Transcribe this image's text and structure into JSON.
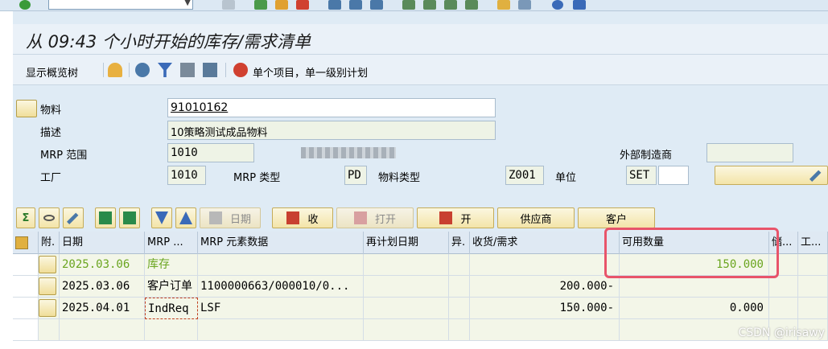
{
  "title": "从 09:43 个小时开始的库存/需求清单",
  "app_toolbar": {
    "show_tree": "显示概览树",
    "single_item": "单个项目，单一级别计划"
  },
  "header": {
    "material_label": "物料",
    "material_value": "91010162",
    "desc_label": "描述",
    "desc_value": "10策略测试成品物料",
    "mrp_area_label": "MRP 范围",
    "mrp_area_value": "1010",
    "ext_proc_label": "外部制造商",
    "ext_proc_value": "",
    "plant_label": "工厂",
    "plant_value": "1010",
    "mrp_type_label": "MRP 类型",
    "mrp_type_value": "PD",
    "mat_type_label": "物料类型",
    "mat_type_value": "Z001",
    "unit_label": "单位",
    "unit_value": "SET"
  },
  "buttons": {
    "date": "日期",
    "receipt": "收",
    "open": "打开",
    "open2": "开",
    "vendor": "供应商",
    "customer": "客户"
  },
  "table": {
    "columns": [
      "附.",
      "日期",
      "MRP ...",
      "MRP 元素数据",
      "再计划日期",
      "异.",
      "收货/需求",
      "可用数量",
      "储...",
      "工..."
    ],
    "rows": [
      {
        "date": "2025.03.06",
        "mrp": "库存",
        "elem": "",
        "resched": "",
        "exc": "",
        "recreq": "",
        "avail": "150.000",
        "green": true
      },
      {
        "date": "2025.03.06",
        "mrp": "客户订单",
        "elem": "1100000663/000010/0...",
        "resched": "",
        "exc": "",
        "recreq": "200.000-",
        "avail": "",
        "green": false
      },
      {
        "date": "2025.04.01",
        "mrp": "IndReq",
        "elem": "LSF",
        "resched": "",
        "exc": "",
        "recreq": "150.000-",
        "avail": "0.000",
        "green": false
      }
    ]
  },
  "watermark": "CSDN @irisawy",
  "colors": {
    "accent_green": "#6aa51f",
    "highlight": "#e8546a"
  }
}
